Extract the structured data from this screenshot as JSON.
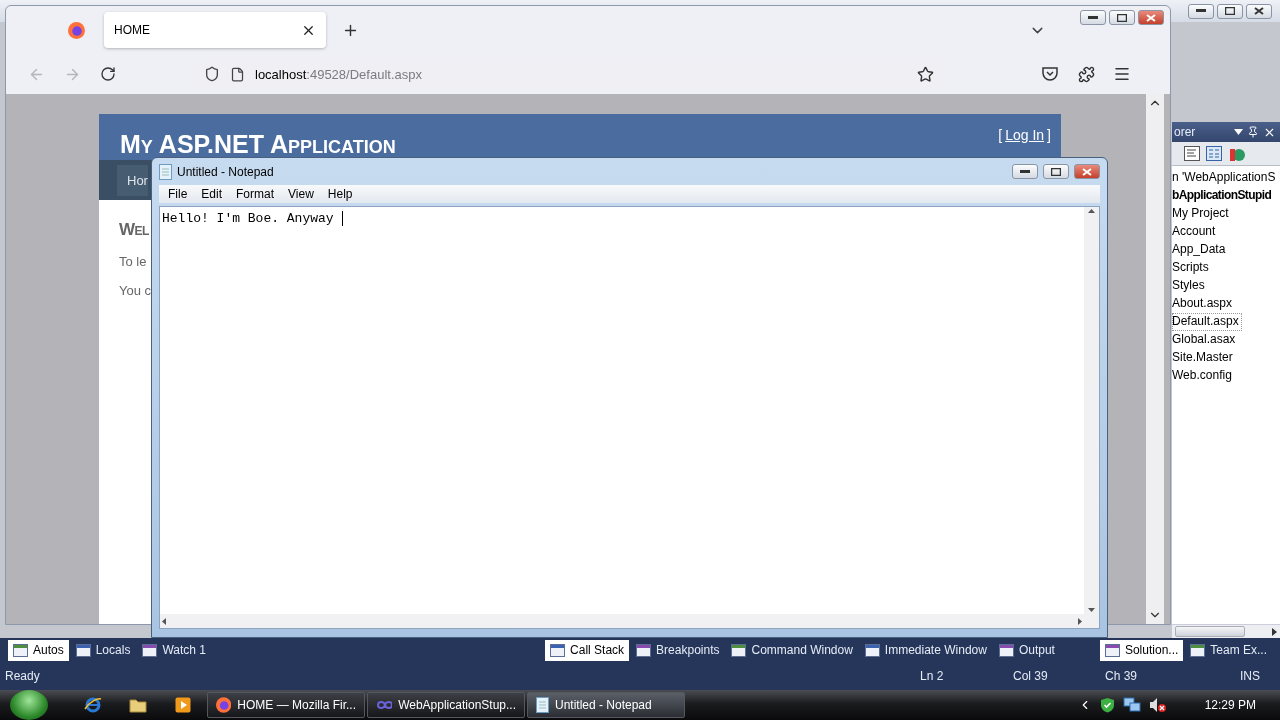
{
  "visual_studio": {
    "solution_explorer": {
      "title": "orer",
      "items": [
        {
          "label": "n 'WebApplicationS",
          "kind": "solution",
          "selected": false
        },
        {
          "label": "bApplicationStupid",
          "kind": "project",
          "selected": false
        },
        {
          "label": "My Project",
          "kind": "item",
          "selected": false
        },
        {
          "label": "Account",
          "kind": "item",
          "selected": false
        },
        {
          "label": "App_Data",
          "kind": "item",
          "selected": false
        },
        {
          "label": "Scripts",
          "kind": "item",
          "selected": false
        },
        {
          "label": "Styles",
          "kind": "item",
          "selected": false
        },
        {
          "label": "About.aspx",
          "kind": "item",
          "selected": false
        },
        {
          "label": "Default.aspx",
          "kind": "item",
          "selected": true
        },
        {
          "label": "Global.asax",
          "kind": "item",
          "selected": false
        },
        {
          "label": "Site.Master",
          "kind": "item",
          "selected": false
        },
        {
          "label": "Web.config",
          "kind": "item",
          "selected": false
        }
      ]
    },
    "tool_tab_groups": [
      [
        {
          "label": "Autos",
          "selected": true
        },
        {
          "label": "Locals",
          "selected": false
        },
        {
          "label": "Watch 1",
          "selected": false
        }
      ],
      [
        {
          "label": "Call Stack",
          "selected": true
        },
        {
          "label": "Breakpoints",
          "selected": false
        },
        {
          "label": "Command Window",
          "selected": false
        },
        {
          "label": "Immediate Window",
          "selected": false
        },
        {
          "label": "Output",
          "selected": false
        }
      ],
      [
        {
          "label": "Solution...",
          "selected": true
        },
        {
          "label": "Team Ex...",
          "selected": false
        }
      ]
    ],
    "status_bar": {
      "message": "Ready",
      "line": "Ln 2",
      "column": "Col 39",
      "char": "Ch 39",
      "mode": "INS"
    }
  },
  "firefox": {
    "tabs": [
      {
        "title": "HOME",
        "selected": true
      }
    ],
    "nav": {
      "back_disabled": true,
      "forward_disabled": true
    },
    "url": {
      "host": "localhost",
      "rest": ":49528/Default.aspx"
    },
    "page": {
      "site_title": "My ASP.NET Application",
      "login_open": "[",
      "login_link": "Log In",
      "login_close": "]",
      "menu": [
        {
          "label": "Hor",
          "selected": true
        }
      ],
      "heading": "Wel",
      "paragraphs": [
        "To le",
        "You c"
      ]
    }
  },
  "notepad": {
    "title": "Untitled - Notepad",
    "menu": [
      "File",
      "Edit",
      "Format",
      "View",
      "Help"
    ],
    "text": "Hello! I'm Boe. Anyway"
  },
  "taskbar": {
    "buttons": [
      {
        "label": "HOME — Mozilla Fir...",
        "kind": "firefox",
        "selected": false
      },
      {
        "label": "WebApplicationStup...",
        "kind": "studio",
        "selected": false
      },
      {
        "label": "Untitled - Notepad",
        "kind": "notepad",
        "selected": true
      }
    ],
    "clock": "12:29 PM"
  }
}
